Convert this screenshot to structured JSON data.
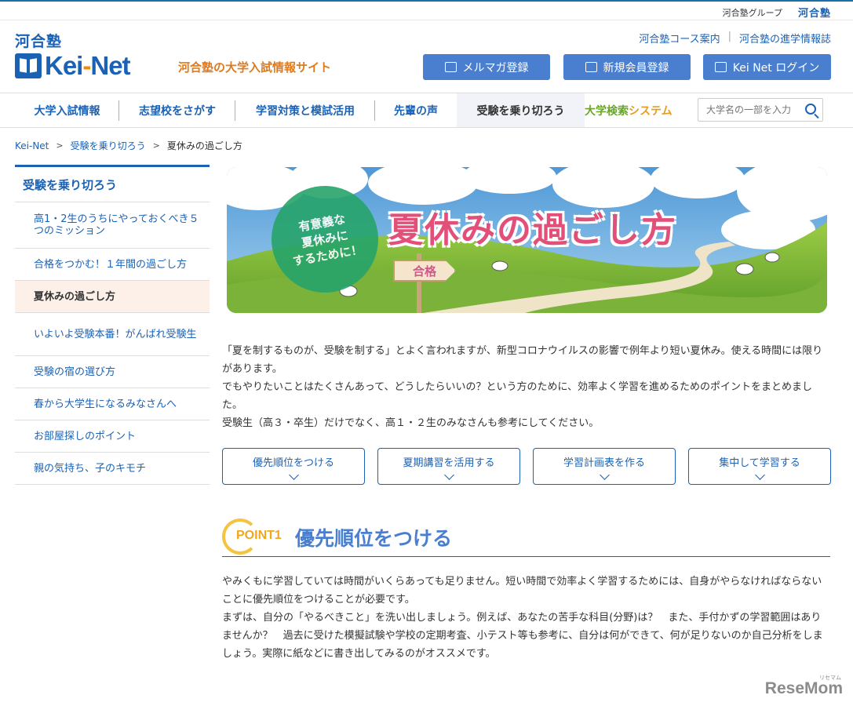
{
  "topbar": {
    "group_text": "河合塾グループ",
    "group_logo": "河合塾"
  },
  "header": {
    "logo_kanji": "河合塾",
    "logo_text_a": "Kei",
    "logo_text_dash": "-",
    "logo_text_b": "Net",
    "tagline": "河合塾の大学入試情報サイト",
    "links": [
      "河合塾コース案内",
      "河合塾の進学情報誌"
    ],
    "buttons": {
      "mail": {
        "label": "メルマガ登録",
        "icon": "mail-icon"
      },
      "member": {
        "label": "新規会員登録",
        "icon": "user-icon"
      },
      "login": {
        "label": "Kei Net ログイン",
        "icon": "login-icon"
      }
    },
    "accent_color": "#1b62b5",
    "button_color": "#4a7fd0"
  },
  "nav": {
    "items": [
      "大学入試情報",
      "志望校をさがす",
      "学習対策と模試活用",
      "先輩の声",
      "受験を乗り切ろう"
    ],
    "active": "受験を乗り切ろう",
    "search_label_a": "大学検索",
    "search_label_b": "システム",
    "search_placeholder": "大学名の一部を入力"
  },
  "breadcrumb": [
    "Kei-Net",
    "受験を乗り切ろう",
    "夏休みの過ごし方"
  ],
  "sidebar": {
    "heading": "受験を乗り切ろう",
    "items": [
      {
        "label": "高1・2生のうちにやっておくべき５つのミッション"
      },
      {
        "label": "合格をつかむ！１年間の過ごし方"
      },
      {
        "label": "夏休みの過ごし方",
        "active": true
      },
      {
        "label": "いよいよ受験本番！がんばれ受験生"
      },
      {
        "label": "受験の宿の選び方"
      },
      {
        "label": "春から大学生になるみなさんへ"
      },
      {
        "label": "お部屋探しのポイント"
      },
      {
        "label": "親の気持ち、子のキモチ"
      }
    ]
  },
  "banner": {
    "title": "夏休みの過ごし方",
    "circle_lines": [
      "有意義な",
      "夏休みに",
      "するために！"
    ],
    "sign": "合格"
  },
  "intro": {
    "paragraphs": [
      "「夏を制するものが、受験を制する」とよく言われますが、新型コロナウイルスの影響で例年より短い夏休み。使える時間には限りがあります。",
      "でもやりたいことはたくさんあって、どうしたらいいの？という方のために、効率よく学習を進めるためのポイントをまとめました。",
      "受験生（高３・卒生）だけでなく、高１・２生のみなさんも参考にしてください。"
    ]
  },
  "jump_buttons": [
    "優先順位をつける",
    "夏期講習を活用する",
    "学習計画表を作る",
    "集中して学習する"
  ],
  "point1": {
    "label": "POINT1",
    "title": "優先順位をつける",
    "paragraphs": [
      "やみくもに学習していては時間がいくらあっても足りません。短い時間で効率よく学習するためには、自身がやらなければならないことに優先順位をつけることが必要です。",
      "まずは、自分の「やるべきこと」を洗い出しましょう。例えば、あなたの苦手な科目(分野)は？　また、手付かずの学習範囲はありませんか？　過去に受けた模擬試験や学校の定期考査、小テスト等も参考に、自分は何ができて、何が足りないのか自己分析をしましょう。実際に紙などに書き出してみるのがオススメです。"
    ]
  },
  "watermark": {
    "text": "ReseMom",
    "small": "リセマム"
  }
}
